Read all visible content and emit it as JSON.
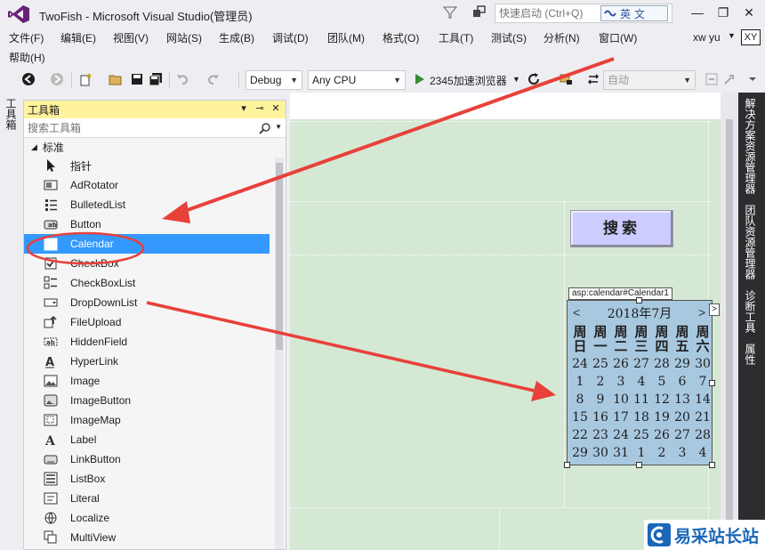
{
  "window": {
    "title": "TwoFish - Microsoft Visual Studio(管理员)",
    "quick_launch_placeholder": "快速启动 (Ctrl+Q)",
    "ime_label": "英文",
    "minimize": "—",
    "restore": "❐",
    "close": "✕"
  },
  "menu": {
    "items": [
      "文件(F)",
      "编辑(E)",
      "视图(V)",
      "网站(S)",
      "生成(B)",
      "调试(D)",
      "团队(M)",
      "格式(O)",
      "工具(T)",
      "测试(S)",
      "分析(N)",
      "窗口(W)"
    ],
    "help": "帮助(H)",
    "user_name": "xw yu",
    "user_initials": "XY"
  },
  "toolbar": {
    "configuration": "Debug",
    "platform": "Any CPU",
    "run_label": "2345加速浏览器",
    "auto_label": "自动"
  },
  "left_tabs": {
    "toolbox": "工具箱"
  },
  "toolbox": {
    "title": "工具箱",
    "search_placeholder": "搜索工具箱",
    "group": "标准",
    "selected_index": 4,
    "items": [
      {
        "label": "指针",
        "icon": "pointer-icon"
      },
      {
        "label": "AdRotator",
        "icon": "adrotator-icon"
      },
      {
        "label": "BulletedList",
        "icon": "bulletedlist-icon"
      },
      {
        "label": "Button",
        "icon": "button-icon"
      },
      {
        "label": "Calendar",
        "icon": "calendar-icon"
      },
      {
        "label": "CheckBox",
        "icon": "checkbox-icon"
      },
      {
        "label": "CheckBoxList",
        "icon": "checkboxlist-icon"
      },
      {
        "label": "DropDownList",
        "icon": "dropdownlist-icon"
      },
      {
        "label": "FileUpload",
        "icon": "fileupload-icon"
      },
      {
        "label": "HiddenField",
        "icon": "hiddenfield-icon"
      },
      {
        "label": "HyperLink",
        "icon": "hyperlink-icon"
      },
      {
        "label": "Image",
        "icon": "image-icon"
      },
      {
        "label": "ImageButton",
        "icon": "imagebutton-icon"
      },
      {
        "label": "ImageMap",
        "icon": "imagemap-icon"
      },
      {
        "label": "Label",
        "icon": "label-icon"
      },
      {
        "label": "LinkButton",
        "icon": "linkbutton-icon"
      },
      {
        "label": "ListBox",
        "icon": "listbox-icon"
      },
      {
        "label": "Literal",
        "icon": "literal-icon"
      },
      {
        "label": "Localize",
        "icon": "localize-icon"
      },
      {
        "label": "MultiView",
        "icon": "multiview-icon"
      }
    ]
  },
  "designer": {
    "search_button": "搜索",
    "calendar_tag": "asp:calendar#Calendar1",
    "calendar": {
      "month_title": "2018年7月",
      "prev": "<",
      "next": ">",
      "smart_tag": ">",
      "day_headers": [
        [
          "周",
          "日"
        ],
        [
          "周",
          "一"
        ],
        [
          "周",
          "二"
        ],
        [
          "周",
          "三"
        ],
        [
          "周",
          "四"
        ],
        [
          "周",
          "五"
        ],
        [
          "周",
          "六"
        ]
      ],
      "weeks": [
        [
          "24",
          "25",
          "26",
          "27",
          "28",
          "29",
          "30"
        ],
        [
          "1",
          "2",
          "3",
          "4",
          "5",
          "6",
          "7"
        ],
        [
          "8",
          "9",
          "10",
          "11",
          "12",
          "13",
          "14"
        ],
        [
          "15",
          "16",
          "17",
          "18",
          "19",
          "20",
          "21"
        ],
        [
          "22",
          "23",
          "24",
          "25",
          "26",
          "27",
          "28"
        ],
        [
          "29",
          "30",
          "31",
          "1",
          "2",
          "3",
          "4"
        ]
      ]
    }
  },
  "right_tabs": [
    "解决方案资源管理器",
    "团队资源管理器",
    "诊断工具",
    "属性"
  ],
  "watermark": {
    "text": "易采站长站",
    "accent": "#1a66b8"
  },
  "colors": {
    "selection": "#3399ff",
    "toolbox_header": "#fff29d",
    "designer_bg": "#d5e8d4",
    "annotation": "#e8413a",
    "calendar_bg": "#a8c8e0"
  }
}
